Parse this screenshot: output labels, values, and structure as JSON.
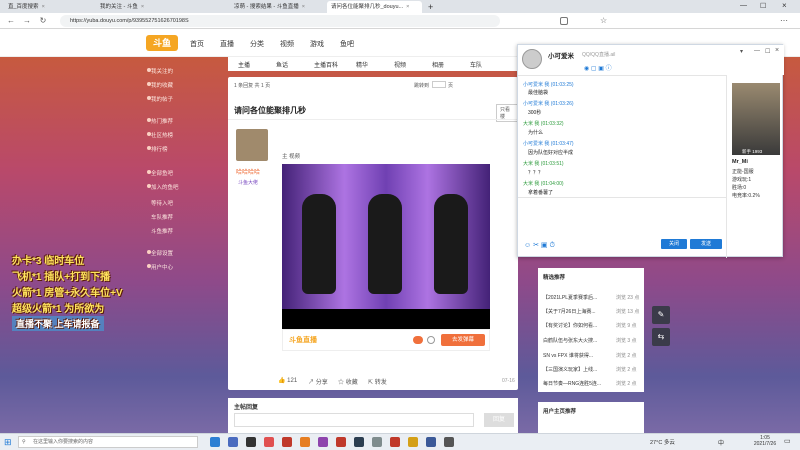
{
  "browser": {
    "tabs": [
      {
        "label": "直_百度搜索",
        "active": false
      },
      {
        "label": "我的关注 - 斗鱼",
        "active": false
      },
      {
        "label": "凉萌 - 搜索结果 - 斗鱼直播",
        "active": false
      },
      {
        "label": "请问各位能聚排几秒_douyu...",
        "active": true
      }
    ],
    "address": "https://yuba.douyu.com/p/93955275162670198S",
    "back": "←",
    "forward": "→",
    "reload": "↻"
  },
  "site": {
    "logo": "斗鱼",
    "nav": [
      "首页",
      "直播",
      "分类",
      "视频",
      "游戏",
      "鱼吧"
    ],
    "subnav": [
      "主播",
      "鱼话",
      "主播百科",
      "精华",
      "视频",
      "相册",
      "车队"
    ]
  },
  "sidebar": {
    "items": [
      "我关注的",
      "我的收藏",
      "我的帖子",
      "热门推荐",
      "社区热榜",
      "排行榜",
      "全部鱼吧",
      "加入的鱼吧",
      "等待入吧",
      "车队推荐",
      "斗鱼推荐",
      "全部设置",
      "用户中心"
    ]
  },
  "promo": {
    "lines": [
      "办卡*3 临时车位",
      "飞机*1 插队+打到下播",
      "火箭*1 房管+永久车位+V",
      "超级火箭*1 为所欲为",
      "直播不聚 上车请报备"
    ]
  },
  "post": {
    "pagination": "1 条回复 共 1 页",
    "page_jump": "跳转到",
    "page_unit": "页",
    "title": "请问各位能聚排几秒",
    "author_name": "哈哈哈哈",
    "author_badge": "斗鱼大佬",
    "video_label": "主 视频",
    "watermark": "斗鱼直播",
    "flag_btn": "去发弹幕",
    "likes": "121",
    "share": "分享",
    "favorite": "收藏",
    "forward": "转发",
    "date": "07-16",
    "view_only": "只看楼"
  },
  "reply": {
    "header": "主帖回复",
    "button": "回复"
  },
  "right_panel": {
    "header": "精选推荐",
    "items": [
      {
        "title": "【2021LPL夏季赛季后...",
        "date": "浏览 23 点"
      },
      {
        "title": "【关于7月26日上海赛...",
        "date": "浏览 13 点"
      },
      {
        "title": "【有奖讨论】你如何看...",
        "date": "浏览 9 点"
      },
      {
        "title": "白鹤队伍与张东大火搜...",
        "date": "浏览 3 点"
      },
      {
        "title": "SN vs FPX 谁将获得...",
        "date": "浏览 2 点"
      },
      {
        "title": "【三国演义玩家】上线...",
        "date": "浏览 2 点"
      },
      {
        "title": "每日节奏—RNG连胜5连...",
        "date": "浏览 2 点"
      }
    ],
    "user_header": "用户主页推荐"
  },
  "chat": {
    "title": "小可爱米",
    "subtitle": "QQ/QQ直播.ail",
    "messages": [
      {
        "name": "小可爱米 我 (01:03:25)",
        "text": "最佳脑袋",
        "green": false
      },
      {
        "name": "小可爱米 我 (01:03:26)",
        "text": "300秒",
        "green": false
      },
      {
        "name": "大米 我 (01:03:32)",
        "text": "为什么",
        "green": true
      },
      {
        "name": "小可爱米 我 (01:03:47)",
        "text": "因为队伍好对应半成",
        "green": false
      },
      {
        "name": "大米 我 (01:03:51)",
        "text": "？？？",
        "green": true
      },
      {
        "name": "大米 我 (01:04:00)",
        "text": "拿着番薯了",
        "green": true
      }
    ],
    "close_btn": "关闭",
    "send_btn": "发送",
    "profile_label": "新手 1993",
    "profile_name": "Mr_Mi",
    "profile_lines": [
      "正能-国服",
      "游戏玩:1",
      "胜场:0",
      "电竞率:0.2%"
    ]
  },
  "taskbar": {
    "search_placeholder": "在这里输入你要搜索的内容",
    "weather": "27°C 多云",
    "time": "1:05",
    "date": "2021/7/26",
    "lang": "中"
  }
}
